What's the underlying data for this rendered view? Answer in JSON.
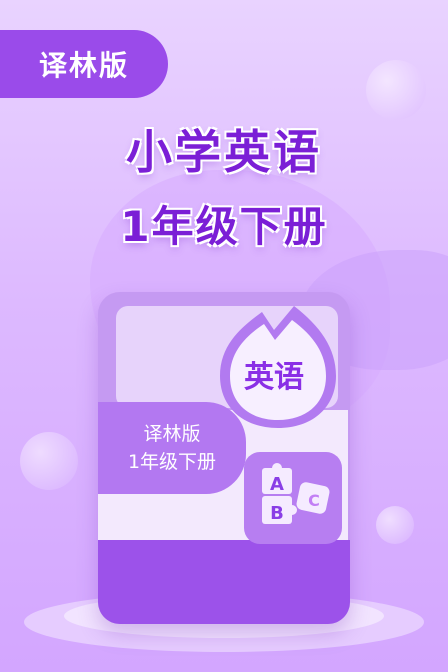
{
  "edition_tag": "译林版",
  "title_main": "小学英语",
  "title_sub": "1年级下册",
  "book": {
    "subject_label": "英语",
    "edition_line": "译林版",
    "grade_line": "1年级下册",
    "puzzle_letters": [
      "A",
      "B",
      "C"
    ]
  },
  "colors": {
    "accent": "#9a4bea",
    "title": "#7b1fd6",
    "background": "#ddb9ff"
  },
  "icons": [
    "subject-drop-icon",
    "abc-puzzle-icon",
    "bubble-icon"
  ]
}
